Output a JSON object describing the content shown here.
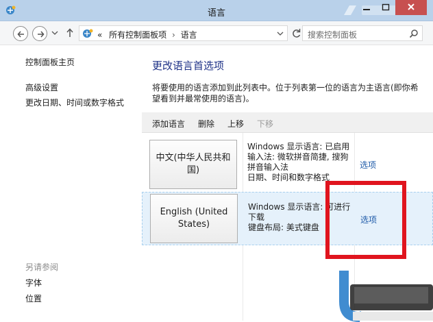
{
  "window": {
    "title": "语言"
  },
  "address": {
    "prefix": "«",
    "crumbs": [
      "所有控制面板项",
      "语言"
    ],
    "separator": "›"
  },
  "search": {
    "placeholder": "搜索控制面板"
  },
  "sidebar": {
    "home": "控制面板主页",
    "links": [
      "高级设置",
      "更改日期、时间或数字格式"
    ],
    "see_also_title": "另请参阅",
    "see_also": [
      "字体",
      "位置"
    ]
  },
  "main": {
    "title": "更改语言首选项",
    "description": "将要使用的语言添加到此列表中。位于列表第一位的语言为主语言(即你希望看到并最常使用的语言)。",
    "toolbar": {
      "add": "添加语言",
      "remove": "删除",
      "up": "上移",
      "down": "下移"
    },
    "languages": [
      {
        "name": "中文(中华人民共和国)",
        "info": [
          "Windows 显示语言: 已启用",
          "输入法: 微软拼音简捷, 搜狗拼音输入法",
          "日期、时间和数字格式"
        ],
        "options": "选项"
      },
      {
        "name": "English (United States)",
        "info": [
          "Windows 显示语言: 可进行下载",
          "键盘布局: 美式键盘"
        ],
        "options": "选项"
      }
    ]
  },
  "colors": {
    "titlebar": "#b9d1ea",
    "link": "#1e5aa8",
    "heading": "#1e3287",
    "highlight": "#e5f1fb",
    "annotation": "#e0141e"
  }
}
